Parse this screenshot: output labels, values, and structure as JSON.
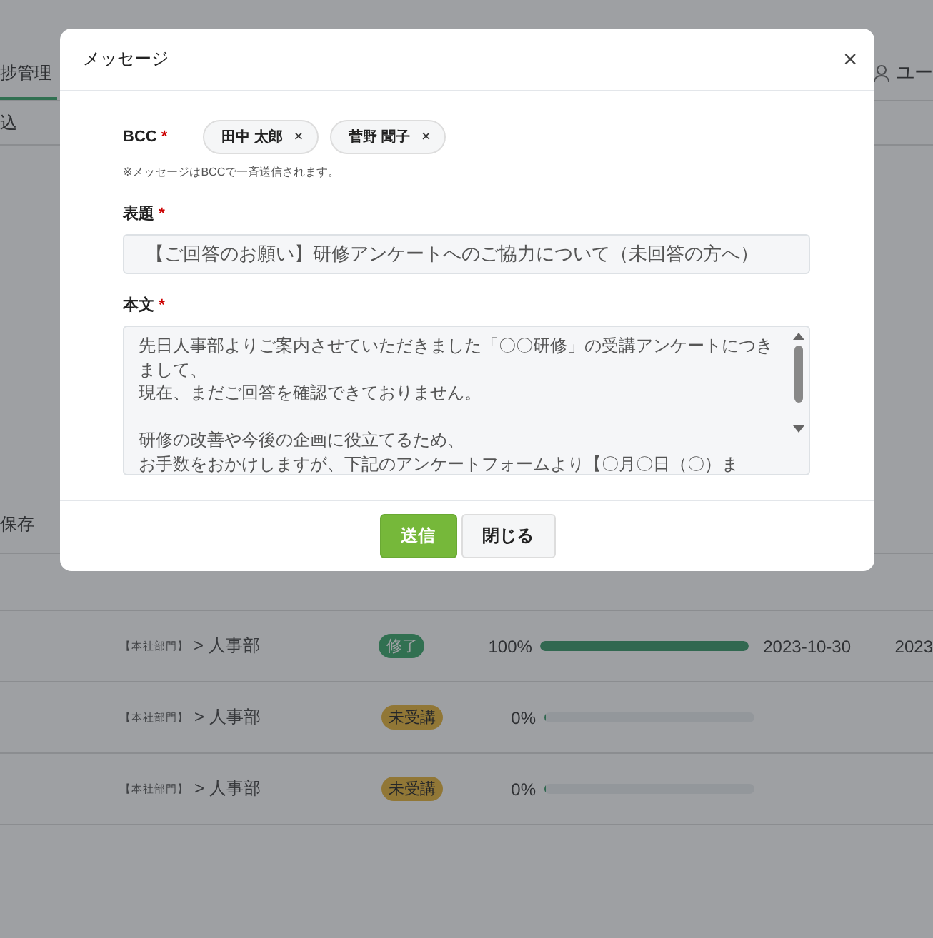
{
  "background": {
    "tabs": [
      {
        "label": "捗管理",
        "selected": true
      }
    ],
    "user_menu": {
      "label": "ユー"
    },
    "toolbar": {
      "label": "込"
    },
    "save_label": "保存",
    "rows": [
      {
        "department": "【本社部門】",
        "name": "> 人事部",
        "status": {
          "label": "修了",
          "kind": "done"
        },
        "percent": "100%",
        "level": 1,
        "date": "2023-10-30",
        "date_2": "2023"
      },
      {
        "department": "【本社部門】",
        "name": "> 人事部",
        "status": {
          "label": "未受講",
          "kind": "pending"
        },
        "percent": "0%",
        "level": 0
      },
      {
        "department": "【本社部門】",
        "name": "> 人事部",
        "status": {
          "label": "未受講",
          "kind": "pending"
        },
        "percent": "0%",
        "level": 0
      }
    ]
  },
  "dialog": {
    "title": "メッセージ",
    "close": "×",
    "bcc": {
      "label": "BCC",
      "required_mark": "*",
      "recipients": [
        {
          "name": "田中 太郎",
          "remove": "×"
        },
        {
          "name": "菅野 聞子",
          "remove": "×"
        }
      ],
      "note": "※メッセージはBCCで一斉送信されます。"
    },
    "subject": {
      "label": "表題",
      "required_mark": "*",
      "value": "【ご回答のお願い】研修アンケートへのご協力について（未回答の方へ）"
    },
    "body": {
      "label": "本文",
      "required_mark": "*",
      "paragraphs": [
        [
          "先日人事部よりご案内させていただきました「〇〇研修」の受講アンケートにつきまして、",
          "現在、まだご回答を確認できておりません。"
        ],
        [
          "研修の改善や今後の企画に役立てるため、",
          "お手数をおかけしますが、下記のアンケートフォームより【〇月〇日（〇）ま"
        ]
      ]
    },
    "buttons": [
      {
        "label": "送信",
        "kind": "primary"
      },
      {
        "label": "閉じる",
        "kind": "secondary"
      }
    ]
  }
}
